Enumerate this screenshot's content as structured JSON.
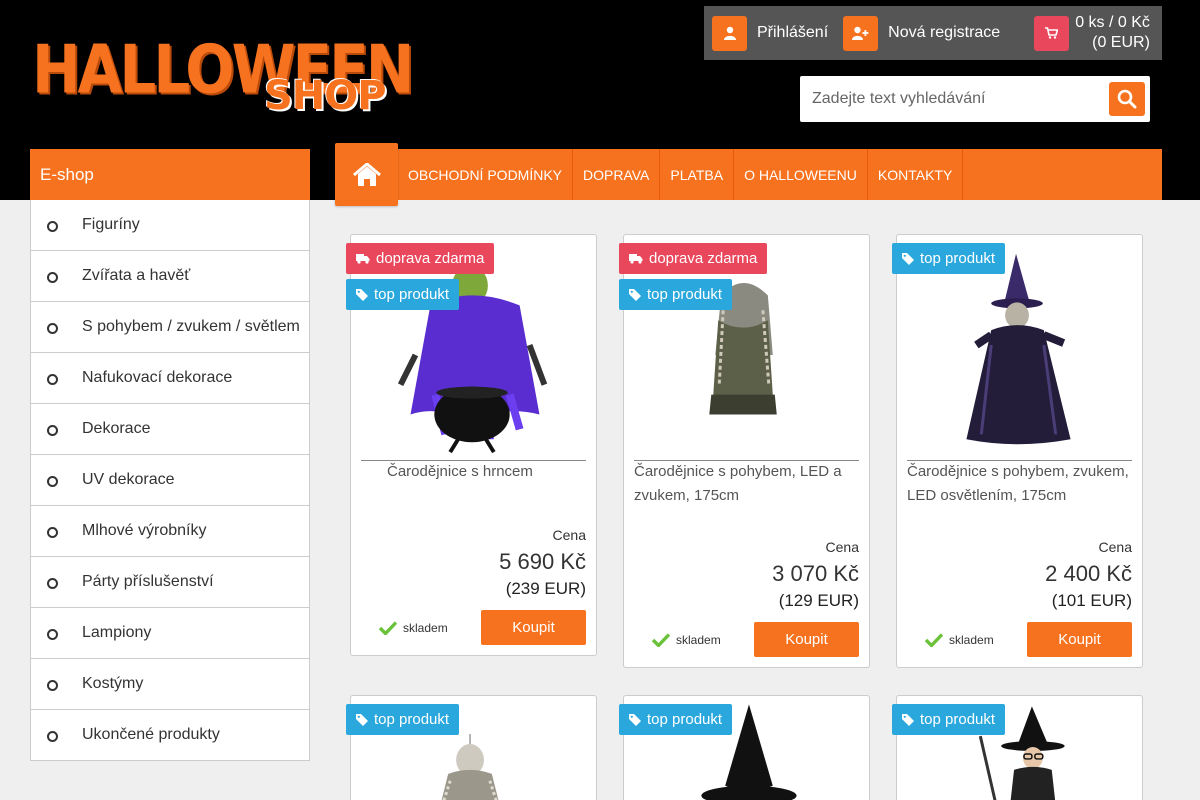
{
  "logo": {
    "main": "HALLOWEEN",
    "sub": "SHOP"
  },
  "userbar": {
    "login_label": "Přihlášení",
    "register_label": "Nová registrace",
    "cart_line1": "0 ks / 0 Kč",
    "cart_line2": "(0 EUR)"
  },
  "search": {
    "placeholder": "Zadejte text vyhledávání"
  },
  "sidebar": {
    "title": "E-shop",
    "items": [
      {
        "label": "Figuríny"
      },
      {
        "label": "Zvířata a havěť"
      },
      {
        "label": "S pohybem / zvukem / světlem"
      },
      {
        "label": "Nafukovací dekorace"
      },
      {
        "label": "Dekorace"
      },
      {
        "label": "UV dekorace"
      },
      {
        "label": "Mlhové výrobníky"
      },
      {
        "label": "Párty příslušenství"
      },
      {
        "label": "Lampiony"
      },
      {
        "label": "Kostýmy"
      },
      {
        "label": "Ukončené produkty"
      }
    ]
  },
  "nav": {
    "items": [
      {
        "label": "OBCHODNÍ PODMÍNKY"
      },
      {
        "label": "DOPRAVA"
      },
      {
        "label": "PLATBA"
      },
      {
        "label": "O HALLOWEENU"
      },
      {
        "label": "KONTAKTY"
      }
    ]
  },
  "products": {
    "p1": {
      "badge_ship": "doprava zdarma",
      "badge_top": "top produkt",
      "name": "Čarodějnice s hrncem",
      "price_label": "Cena",
      "price_czk": "5 690 Kč",
      "price_eur": "(239 EUR)",
      "stock": "skladem",
      "buy": "Koupit"
    },
    "p2": {
      "badge_ship": "doprava zdarma",
      "badge_top": "top produkt",
      "name": "Čarodějnice s pohybem, LED a zvukem, 175cm",
      "price_label": "Cena",
      "price_czk": "3 070 Kč",
      "price_eur": "(129 EUR)",
      "stock": "skladem",
      "buy": "Koupit"
    },
    "p3": {
      "badge_top": "top produkt",
      "name": "Čarodějnice s pohybem, zvukem, LED osvětlením, 175cm",
      "price_label": "Cena",
      "price_czk": "2 400 Kč",
      "price_eur": "(101 EUR)",
      "stock": "skladem",
      "buy": "Koupit"
    },
    "p4": {
      "badge_top": "top produkt"
    },
    "p5": {
      "badge_top": "top produkt"
    },
    "p6": {
      "badge_top": "top produkt"
    }
  },
  "colors": {
    "accent": "#f7721e",
    "ship_badge": "#e8475c",
    "top_badge": "#2aa8de",
    "stock_check": "#6ac13a"
  }
}
